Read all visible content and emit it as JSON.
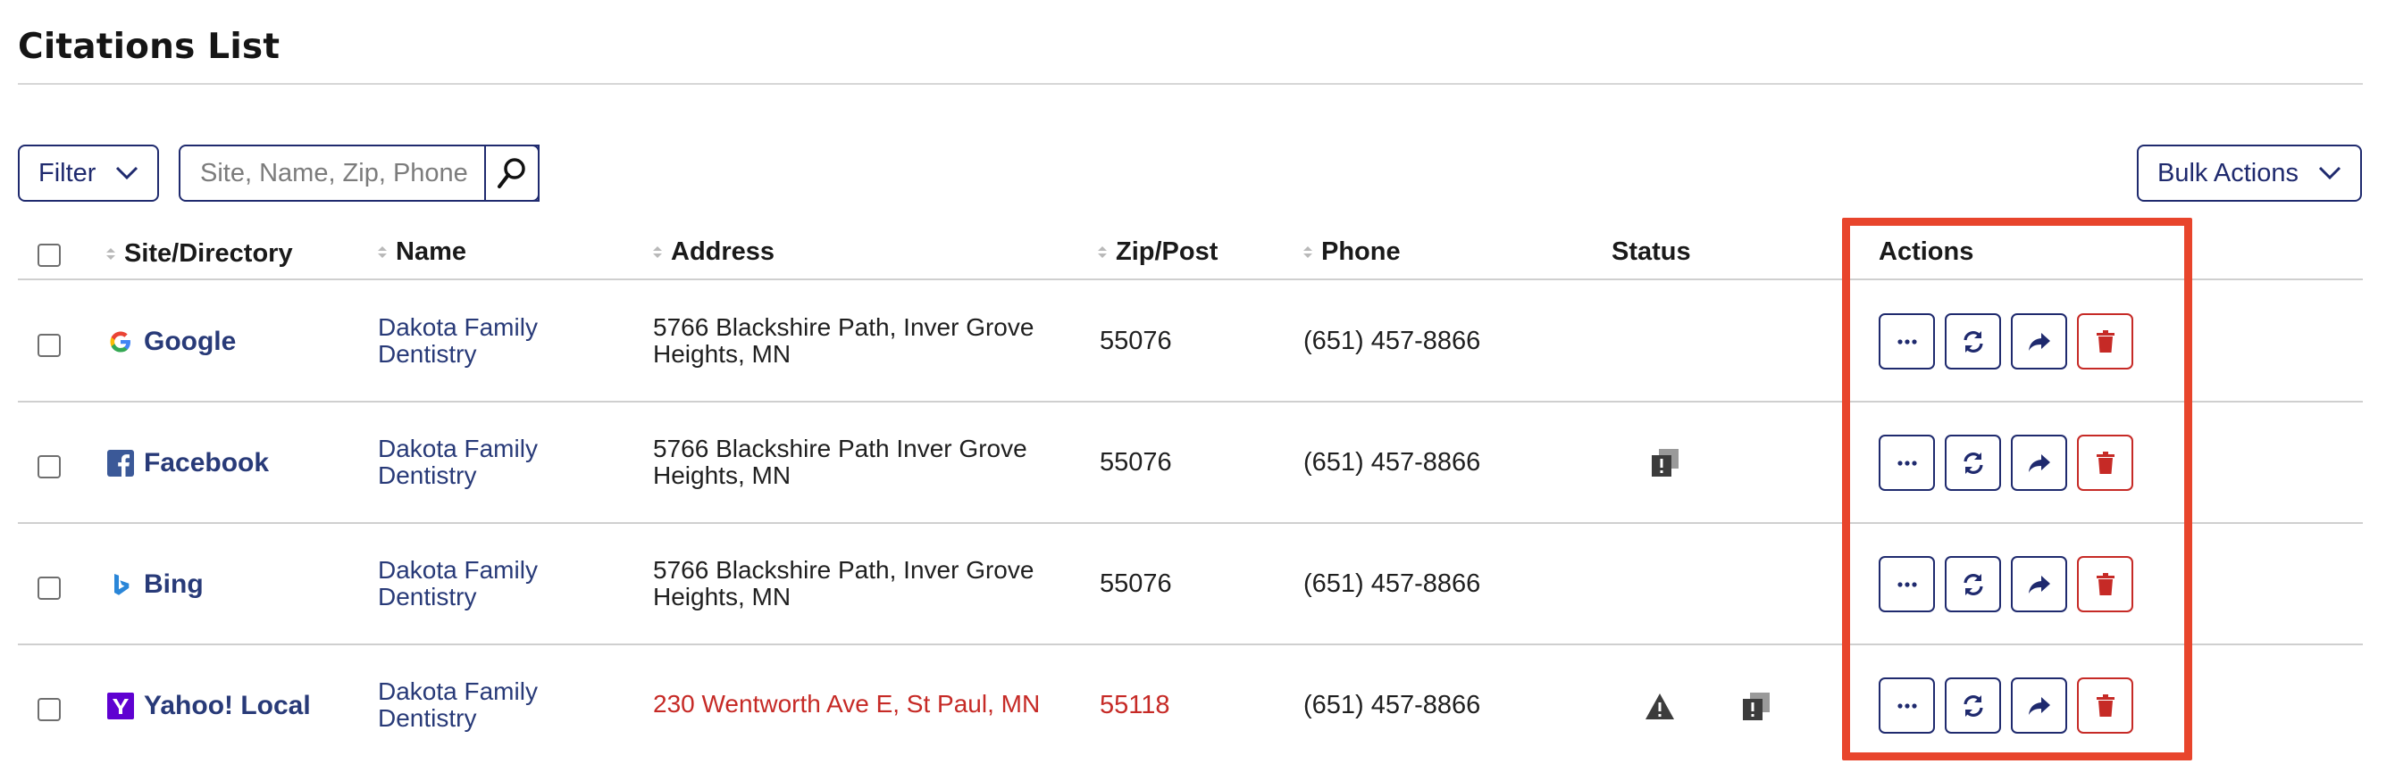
{
  "page": {
    "title": "Citations List"
  },
  "toolbar": {
    "filter_label": "Filter",
    "search_placeholder": "Site, Name, Zip, Phone",
    "bulk_actions_label": "Bulk Actions"
  },
  "table": {
    "columns": {
      "site": "Site/Directory",
      "name": "Name",
      "address": "Address",
      "zip": "Zip/Post",
      "phone": "Phone",
      "status": "Status",
      "actions": "Actions"
    },
    "rows": [
      {
        "site": "Google",
        "site_icon": "google-icon",
        "name": "Dakota Family Dentistry",
        "address": "5766 Blackshire Path, Inver Grove Heights, MN",
        "zip": "55076",
        "phone": "(651) 457-8866",
        "status_icons": []
      },
      {
        "site": "Facebook",
        "site_icon": "facebook-icon",
        "name": "Dakota Family Dentistry",
        "address": "5766 Blackshire Path Inver Grove Heights, MN",
        "zip": "55076",
        "phone": "(651) 457-8866",
        "status_icons": [
          "duplicate-alert-icon"
        ]
      },
      {
        "site": "Bing",
        "site_icon": "bing-icon",
        "name": "Dakota Family Dentistry",
        "address": "5766 Blackshire Path, Inver Grove Heights, MN",
        "zip": "55076",
        "phone": "(651) 457-8866",
        "status_icons": []
      },
      {
        "site": "Yahoo! Local",
        "site_icon": "yahoo-icon",
        "name": "Dakota Family Dentistry",
        "address": "230 Wentworth Ave E, St Paul, MN",
        "zip": "55118",
        "phone": "(651) 457-8866",
        "address_mismatch": true,
        "zip_mismatch": true,
        "status_icons": [
          "warning-icon",
          "duplicate-alert-icon"
        ]
      }
    ]
  },
  "actions_icons": [
    "more-icon",
    "sync-icon",
    "share-icon",
    "trash-icon"
  ],
  "colors": {
    "primary": "#1f2a6e",
    "link": "#283a78",
    "error": "#c62a26",
    "highlight": "#e8452c"
  }
}
